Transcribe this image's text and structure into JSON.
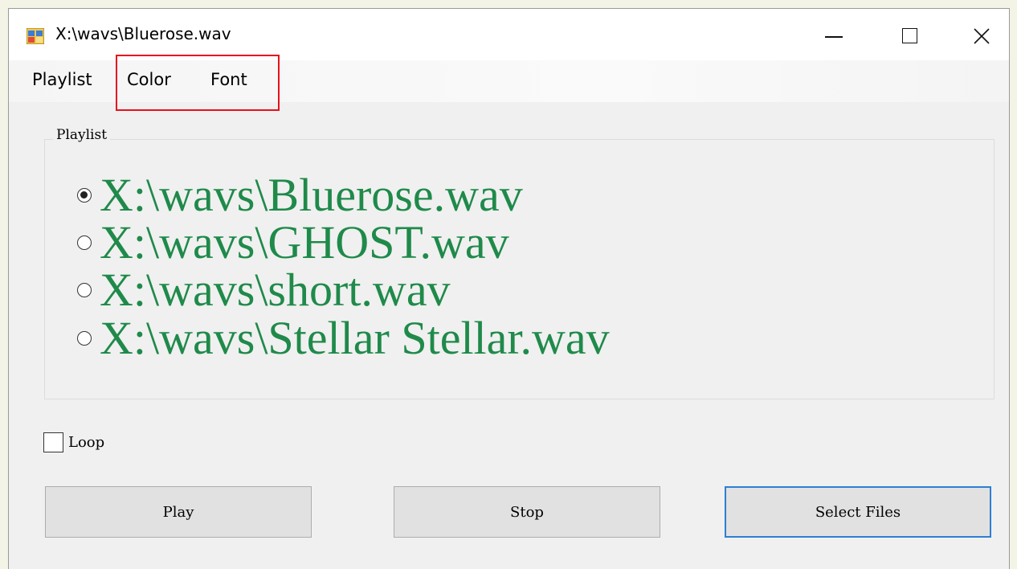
{
  "window": {
    "title": "X:\\wavs\\Bluerose.wav",
    "icon": "app-icon"
  },
  "menu": {
    "items": [
      {
        "label": "Playlist"
      },
      {
        "label": "Color"
      },
      {
        "label": "Font"
      }
    ],
    "highlighted": [
      "Color",
      "Font"
    ],
    "highlight_color": "#e8101c"
  },
  "playlist": {
    "group_label": "Playlist",
    "items": [
      {
        "label": "X:\\wavs\\Bluerose.wav",
        "selected": true
      },
      {
        "label": "X:\\wavs\\GHOST.wav",
        "selected": false
      },
      {
        "label": "X:\\wavs\\short.wav",
        "selected": false
      },
      {
        "label": "X:\\wavs\\Stellar Stellar.wav",
        "selected": false
      }
    ],
    "text_color": "#1f8a4a"
  },
  "loop": {
    "label": "Loop",
    "checked": false
  },
  "buttons": {
    "play": "Play",
    "stop": "Stop",
    "select_files": "Select Files",
    "focus_color": "#2c7fd4"
  }
}
